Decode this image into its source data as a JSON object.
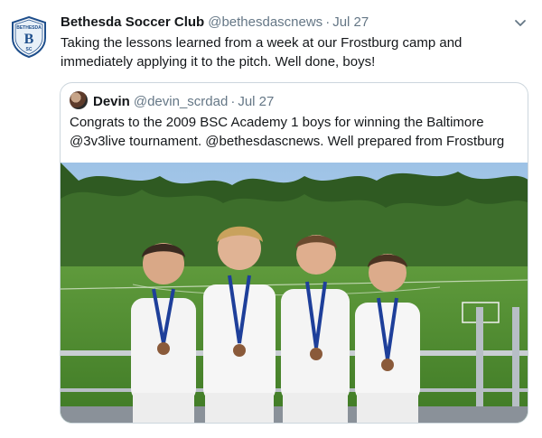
{
  "tweet": {
    "author_name": "Bethesda Soccer Club",
    "handle": "@bethesdascnews",
    "separator": "·",
    "date": "Jul 27",
    "text": "Taking the lessons learned from a week at our Frostburg camp and immediately applying it to the pitch. Well done, boys!",
    "avatar_logo": {
      "line1": "BETHESDA",
      "letter": "B",
      "line2": "SC"
    }
  },
  "quoted_tweet": {
    "author_name": "Devin",
    "handle": "@devin_scrdad",
    "separator": "·",
    "date": "Jul 27",
    "text": "Congrats to the 2009 BSC Academy 1 boys for winning the Baltimore @3v3live tournament. @bethesdascnews. Well prepared from Frostburg"
  },
  "colors": {
    "text": "#14171a",
    "secondary_text": "#657786",
    "border": "#ccd6dd",
    "logo_blue": "#1f4f8c"
  },
  "icons": {
    "caret": "chevron-down-icon"
  }
}
